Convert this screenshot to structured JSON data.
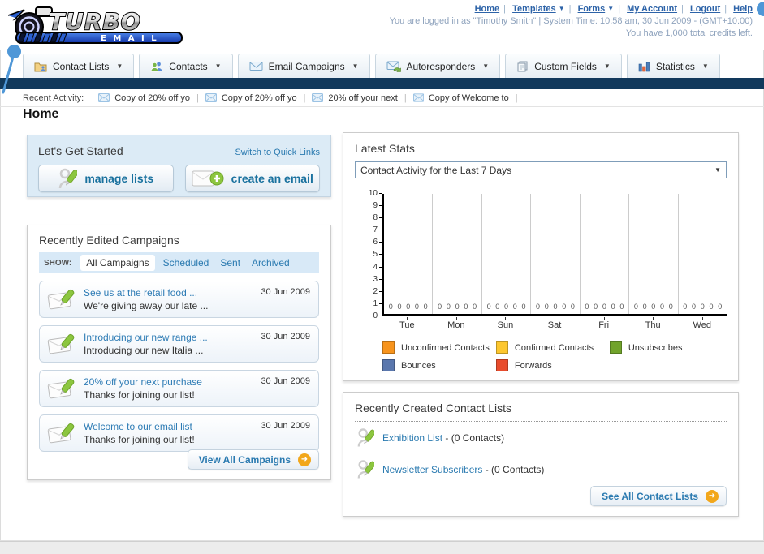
{
  "page": {
    "title": "Home"
  },
  "header": {
    "logo": {
      "brand": "TURBO",
      "brand_sub": "EMAIL"
    },
    "nav": [
      {
        "label": "Home",
        "dropdown": false
      },
      {
        "label": "Templates",
        "dropdown": true
      },
      {
        "label": "Forms",
        "dropdown": true
      },
      {
        "label": "My Account",
        "dropdown": false
      },
      {
        "label": "Logout",
        "dropdown": false
      },
      {
        "label": "Help",
        "dropdown": false
      }
    ],
    "status_line1": "You are logged in as \"Timothy Smith\" | System Time: 10:58 am, 30 Jun 2009 - (GMT+10:00)",
    "status_line2": "You have 1,000 total credits left."
  },
  "tabs": [
    {
      "label": "Contact Lists",
      "icon": "contact-lists-icon"
    },
    {
      "label": "Contacts",
      "icon": "contacts-icon"
    },
    {
      "label": "Email Campaigns",
      "icon": "email-campaigns-icon"
    },
    {
      "label": "Autoresponders",
      "icon": "autoresponders-icon"
    },
    {
      "label": "Custom Fields",
      "icon": "custom-fields-icon"
    },
    {
      "label": "Statistics",
      "icon": "statistics-icon"
    }
  ],
  "recent_activity": {
    "label": "Recent Activity:",
    "items": [
      {
        "label": "Copy of 20% off yo"
      },
      {
        "label": "Copy of 20% off yo"
      },
      {
        "label": "20% off your next "
      },
      {
        "label": "Copy of Welcome to"
      }
    ]
  },
  "get_started": {
    "title": "Let's Get Started",
    "switch_link": "Switch to Quick Links",
    "manage_lists_label": "manage lists",
    "create_email_label": "create an email"
  },
  "campaigns": {
    "title": "Recently Edited Campaigns",
    "show_label": "SHOW:",
    "filters": [
      {
        "label": "All Campaigns",
        "selected": true
      },
      {
        "label": "Scheduled",
        "selected": false
      },
      {
        "label": "Sent",
        "selected": false
      },
      {
        "label": "Archived",
        "selected": false
      }
    ],
    "items": [
      {
        "title": "See us at the retail food ...",
        "subtitle": "We're giving away our late ...",
        "date": "30 Jun 2009"
      },
      {
        "title": "Introducing our new range ...",
        "subtitle": "Introducing our new Italia ...",
        "date": "30 Jun 2009"
      },
      {
        "title": "20% off your next purchase",
        "subtitle": "Thanks for joining our list!",
        "date": "30 Jun 2009"
      },
      {
        "title": "Welcome to our email list",
        "subtitle": "Thanks for joining our list!",
        "date": "30 Jun 2009"
      }
    ],
    "view_all_label": "View All Campaigns"
  },
  "stats": {
    "title": "Latest Stats",
    "dropdown_value": "Contact Activity for the Last 7 Days"
  },
  "chart_data": {
    "type": "line",
    "title": "Contact Activity for the Last 7 Days",
    "categories": [
      "Tue",
      "Mon",
      "Sun",
      "Sat",
      "Fri",
      "Thu",
      "Wed"
    ],
    "series": [
      {
        "name": "Unconfirmed Contacts",
        "color": "#f7941d",
        "values": [
          0,
          0,
          0,
          0,
          0,
          0,
          0
        ]
      },
      {
        "name": "Confirmed Contacts",
        "color": "#fdc72f",
        "values": [
          0,
          0,
          0,
          0,
          0,
          0,
          0
        ]
      },
      {
        "name": "Unsubscribes",
        "color": "#71a32b",
        "values": [
          0,
          0,
          0,
          0,
          0,
          0,
          0
        ]
      },
      {
        "name": "Bounces",
        "color": "#5a77ad",
        "values": [
          0,
          0,
          0,
          0,
          0,
          0,
          0
        ]
      },
      {
        "name": "Forwards",
        "color": "#e84c2d",
        "values": [
          0,
          0,
          0,
          0,
          0,
          0,
          0
        ]
      }
    ],
    "xlabel": "",
    "ylabel": "",
    "ylim": [
      0,
      10
    ],
    "ytick_step": 1,
    "grid": "vertical-only",
    "legend_position": "bottom",
    "point_labels_shown": true
  },
  "contact_lists": {
    "title": "Recently Created Contact Lists",
    "items": [
      {
        "name": "Exhibition List",
        "detail": "- (0 Contacts)"
      },
      {
        "name": "Newsletter Subscribers",
        "detail": "- (0 Contacts)"
      }
    ],
    "see_all_label": "See All Contact Lists"
  }
}
